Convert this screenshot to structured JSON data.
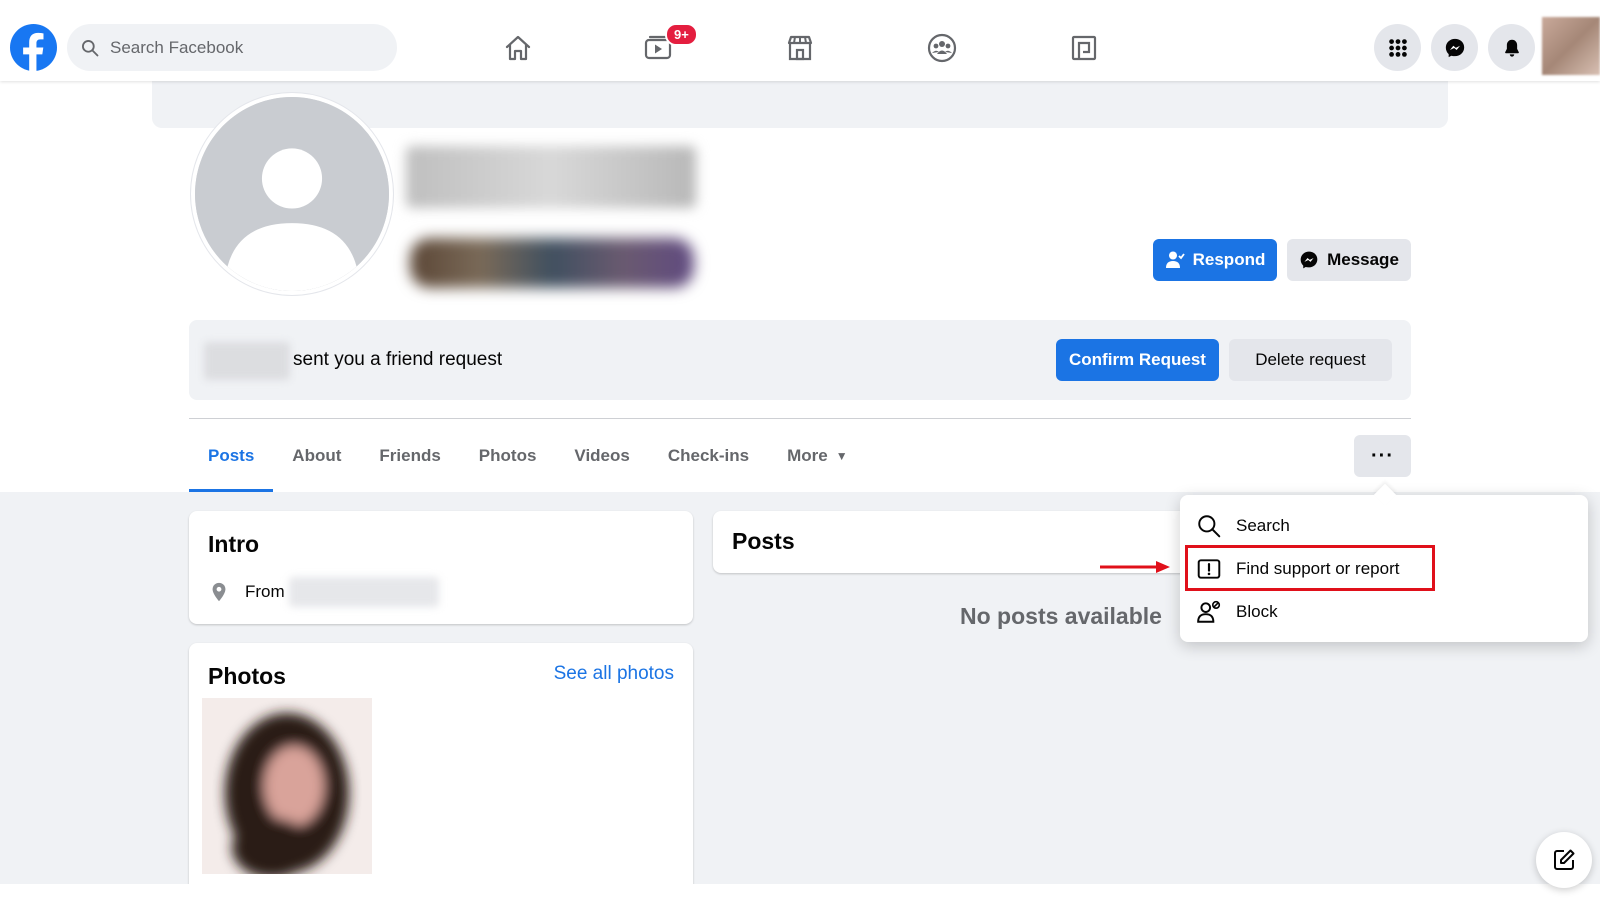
{
  "header": {
    "search": {
      "placeholder": "Search Facebook"
    },
    "watch_badge": "9+",
    "nav_icons": [
      "home-icon",
      "watch-icon",
      "marketplace-icon",
      "groups-icon",
      "gaming-icon"
    ],
    "right_icons": [
      "menu-grid-icon",
      "messenger-icon",
      "notifications-icon"
    ]
  },
  "profile": {
    "respond_label": "Respond",
    "message_label": "Message"
  },
  "friend_request": {
    "text": "sent you a friend request",
    "confirm_label": "Confirm Request",
    "delete_label": "Delete request"
  },
  "tabs": [
    {
      "label": "Posts",
      "active": true
    },
    {
      "label": "About"
    },
    {
      "label": "Friends"
    },
    {
      "label": "Photos"
    },
    {
      "label": "Videos"
    },
    {
      "label": "Check-ins"
    },
    {
      "label": "More"
    }
  ],
  "more_button": "···",
  "intro": {
    "title": "Intro",
    "from_label": "From"
  },
  "posts": {
    "title": "Posts",
    "empty_text": "No posts available"
  },
  "photos": {
    "title": "Photos",
    "see_all": "See all photos"
  },
  "menu": {
    "items": [
      {
        "label": "Search",
        "icon": "search-icon"
      },
      {
        "label": "Find support or report",
        "icon": "report-icon"
      },
      {
        "label": "Block",
        "icon": "block-user-icon"
      }
    ]
  },
  "colors": {
    "accent": "#1b74e4",
    "highlight": "#e0101a",
    "badge": "#e41e3f"
  }
}
